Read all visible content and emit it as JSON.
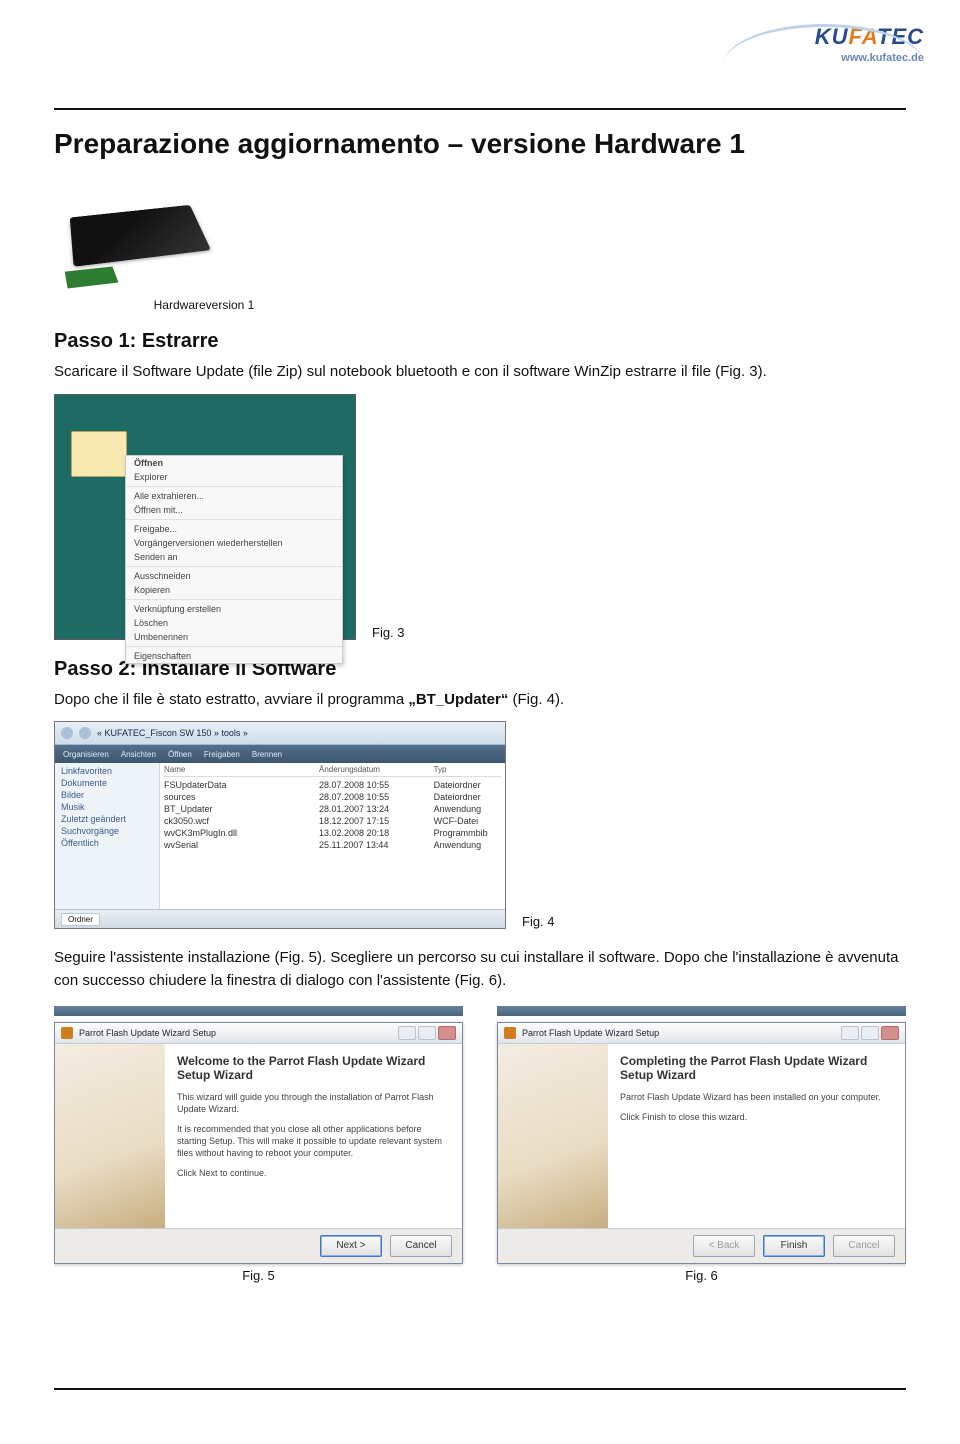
{
  "logo": {
    "brand_pre": "KU",
    "brand_mid": "FA",
    "brand_suf": "TEC",
    "url": "www.kufatec.de"
  },
  "page_title": "Preparazione aggiornamento – versione Hardware 1",
  "device_caption": "Hardwareversion 1",
  "step1": {
    "title": "Passo 1: Estrarre",
    "text": "Scaricare il Software Update (file Zip) sul notebook bluetooth e con il software WinZip estrarre il file (Fig. 3)."
  },
  "fig3": {
    "caption": "Fig. 3",
    "menu": [
      "Öffnen",
      "Explorer",
      "Alle extrahieren...",
      "Öffnen mit...",
      "Freigabe...",
      "Vorgängerversionen wiederherstellen",
      "Senden an",
      "Ausschneiden",
      "Kopieren",
      "Verknüpfung erstellen",
      "Löschen",
      "Umbenennen",
      "Eigenschaften"
    ]
  },
  "step2": {
    "title": "Passo 2: Installare il Software",
    "text_pre": "Dopo che il file è stato estratto, avviare il programma ",
    "text_bold": "„BT_Updater“",
    "text_post": " (Fig. 4)."
  },
  "fig4": {
    "caption": "Fig. 4",
    "breadcrumb": "« KUFATEC_Fiscon SW 150 » tools »",
    "toolbar": [
      "Organisieren",
      "Ansichten",
      "Öffnen",
      "Freigaben",
      "Brennen"
    ],
    "navpane": [
      "Linkfavoriten",
      "Dokumente",
      "Bilder",
      "Musik",
      "Zuletzt geändert",
      "Suchvorgänge",
      "Öffentlich"
    ],
    "columns": [
      "Name",
      "Änderungsdatum",
      "Typ"
    ],
    "rows": [
      {
        "n": "FSUpdaterData",
        "d": "28.07.2008 10:55",
        "t": "Dateiordner"
      },
      {
        "n": "sources",
        "d": "28.07.2008 10:55",
        "t": "Dateiordner"
      },
      {
        "n": "BT_Updater",
        "d": "28.01.2007 13:24",
        "t": "Anwendung"
      },
      {
        "n": "ck3050.wcf",
        "d": "18.12.2007 17:15",
        "t": "WCF-Datei"
      },
      {
        "n": "wvCK3mPlugIn.dll",
        "d": "13.02.2008 20:18",
        "t": "Programmbib"
      },
      {
        "n": "wvSerial",
        "d": "25.11.2007 13:44",
        "t": "Anwendung"
      }
    ],
    "status": "Ordner"
  },
  "para5": "Seguire l'assistente installazione (Fig. 5). Scegliere un percorso su cui installare il software. Dopo che l'installazione è avvenuta con successo chiudere la finestra di dialogo con l'assistente (Fig. 6).",
  "fig5": {
    "window_title": "Parrot Flash Update Wizard Setup",
    "heading": "Welcome to the Parrot Flash Update Wizard Setup Wizard",
    "p1": "This wizard will guide you through the installation of Parrot Flash Update Wizard.",
    "p2": "It is recommended that you close all other applications before starting Setup. This will make it possible to update relevant system files without having to reboot your computer.",
    "p3": "Click Next to continue.",
    "btn_next": "Next >",
    "btn_cancel": "Cancel",
    "caption": "Fig. 5"
  },
  "fig6": {
    "window_title": "Parrot Flash Update Wizard Setup",
    "heading": "Completing the Parrot Flash Update Wizard Setup Wizard",
    "p1": "Parrot Flash Update Wizard has been installed on your computer.",
    "p2": "Click Finish to close this wizard.",
    "btn_back": "< Back",
    "btn_finish": "Finish",
    "btn_cancel": "Cancel",
    "caption": "Fig. 6"
  }
}
